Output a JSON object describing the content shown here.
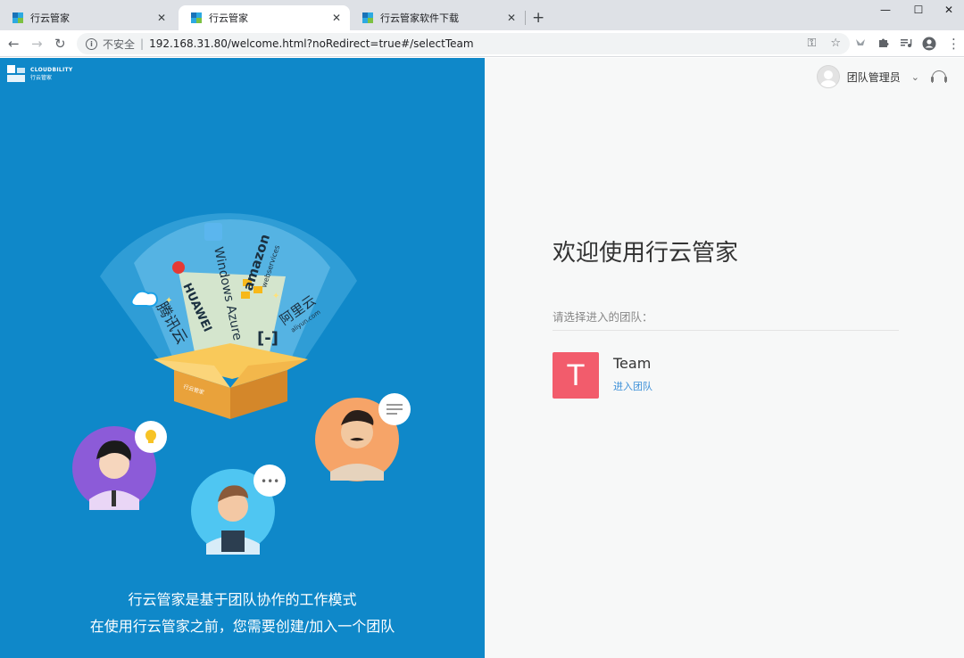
{
  "browser": {
    "tabs": [
      {
        "title": "行云管家",
        "active": false
      },
      {
        "title": "行云管家",
        "active": true
      },
      {
        "title": "行云管家软件下载",
        "active": false
      }
    ],
    "new_tab": "+",
    "window_controls": {
      "minimize": "—",
      "maximize": "☐",
      "close": "✕"
    },
    "nav": {
      "back": "←",
      "forward": "→",
      "reload": "↻"
    },
    "address": {
      "security_label": "不安全",
      "separator": "|",
      "url": "192.168.31.80/welcome.html?noRedirect=true#/selectTeam"
    },
    "omnibox_icons": {
      "key": "⚿",
      "star": "☆"
    },
    "extensions": [
      "bird-icon",
      "puzzle-icon",
      "playlist-icon",
      "profile-icon",
      "menu-icon"
    ],
    "menu_dots": "⋮"
  },
  "left": {
    "logo": {
      "brand_en": "CLOUDBILITY",
      "brand_cn": "行云管家"
    },
    "clouds": {
      "tencent": "腾讯云",
      "huawei": "HUAWEI",
      "azure": "Windows Azure",
      "amazon": "amazon",
      "amazon_sub": "webservices",
      "aliyun": "阿里云",
      "aliyun_sub": "aliyun.com"
    },
    "box_label": "行云管家",
    "caption_line1": "行云管家是基于团队协作的工作模式",
    "caption_line2": "在使用行云管家之前，您需要创建/加入一个团队"
  },
  "right": {
    "user": {
      "name": "团队管理员",
      "dropdown": "⌄"
    },
    "welcome_title": "欢迎使用行云管家",
    "select_label": "请选择进入的团队：",
    "teams": [
      {
        "initial": "T",
        "name": "Team",
        "action": "进入团队"
      }
    ]
  },
  "colors": {
    "left_bg": "#0f88c9",
    "team_avatar": "#f25c6c",
    "link": "#3b8fd8"
  }
}
